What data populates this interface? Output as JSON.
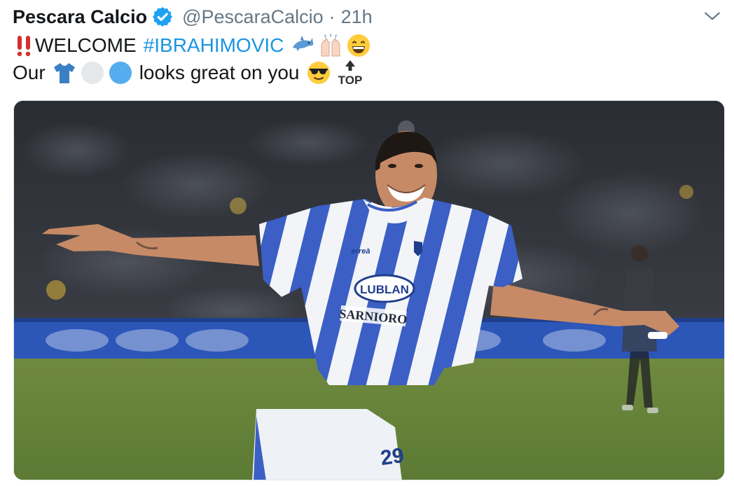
{
  "tweet": {
    "display_name": "Pescara Calcio",
    "handle": "@PescaraCalcio",
    "separator": "·",
    "time": "21h",
    "verified": true,
    "line1_text": "WELCOME",
    "hashtag": "#IBRAHIMOVIC",
    "line2_start": "Our",
    "line2_mid": "looks great on you",
    "top_label": "TOP"
  },
  "icons": {
    "verified": "verified-badge-icon",
    "more": "chevron-down-icon",
    "emoji_line1": [
      "double-exclamation-icon",
      "dolphin-icon",
      "raising-hands-icon",
      "grinning-face-icon"
    ],
    "emoji_line2": [
      "tshirt-icon",
      "white-circle-icon",
      "blue-circle-icon",
      "sunglasses-face-icon",
      "top-arrow-icon"
    ]
  },
  "colors": {
    "text": "#14171a",
    "secondary": "#657786",
    "hashtag": "#1b95e0",
    "verified": "#1da1f2",
    "jersey_blue": "#3b5fc4"
  },
  "photo": {
    "sponsor_1": "LUBLAN",
    "sponsor_2": "SARNIORO",
    "shirt_brand": "erreà",
    "shirt_number": "29"
  }
}
